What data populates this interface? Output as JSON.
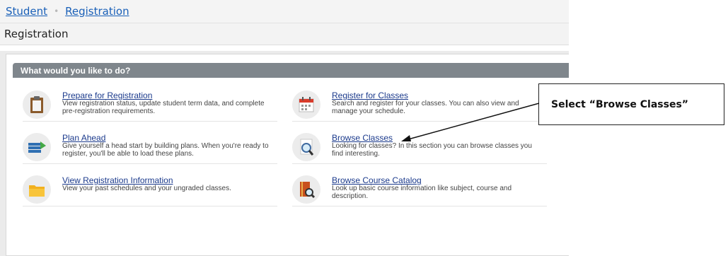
{
  "breadcrumb": {
    "student": "Student",
    "separator": "•",
    "registration": "Registration"
  },
  "page_title": "Registration",
  "panel": {
    "title": "What would you like to do?"
  },
  "items": {
    "prepare": {
      "label": "Prepare for Registration",
      "desc": "View registration status, update student term data, and complete pre-registration requirements.",
      "icon": "clipboard-icon"
    },
    "register": {
      "label": "Register for Classes",
      "desc": "Search and register for your classes. You can also view and manage your schedule.",
      "icon": "calendar-icon"
    },
    "plan": {
      "label": "Plan Ahead",
      "desc": "Give yourself a head start by building plans. When you're ready to register, you'll be able to load these plans.",
      "icon": "plan-list-icon"
    },
    "browse": {
      "label": "Browse Classes",
      "desc": "Looking for classes? In this section you can browse classes you find interesting.",
      "icon": "magnifier-icon"
    },
    "view": {
      "label": "View Registration Information",
      "desc": "View your past schedules and your ungraded classes.",
      "icon": "folder-icon"
    },
    "catalog": {
      "label": "Browse Course Catalog",
      "desc": "Look up basic course information like subject, course and description.",
      "icon": "catalog-book-icon"
    }
  },
  "callout": {
    "text": "Select “Browse Classes”"
  },
  "colors": {
    "link": "#1b3a8c",
    "breadcrumb_link": "#1a60b8",
    "panel_header": "#7f868c"
  }
}
